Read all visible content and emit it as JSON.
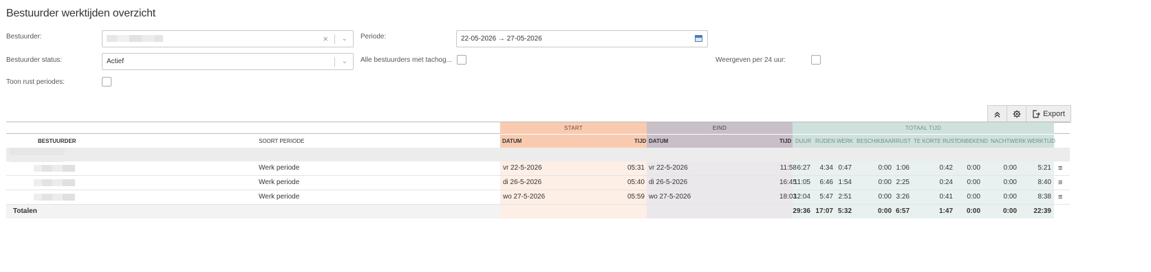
{
  "title": "Bestuurder werktijden overzicht",
  "filters": {
    "bestuurder_label": "Bestuurder:",
    "periode_label": "Periode:",
    "periode_value": "22-05-2026 → 27-05-2026",
    "status_label": "Bestuurder status:",
    "status_value": "Actief",
    "tachograaf_label": "Alle bestuurders met tachog...",
    "per24_label": "Weergeven per 24 uur:",
    "rust_label": "Toon rust periodes:"
  },
  "toolbar": {
    "export_label": "Export"
  },
  "table": {
    "bands": {
      "start": "START",
      "eind": "EIND",
      "totaal": "TOTAAL TIJD"
    },
    "headers": {
      "bestuurder": "BESTUURDER",
      "soort": "SOORT PERIODE",
      "start_datum": "DATUM",
      "start_tijd": "TIJD",
      "eind_datum": "DATUM",
      "eind_tijd": "TIJD",
      "duur": "DUUR",
      "rijden": "RIJDEN",
      "werk": "WERK",
      "beschikbaar": "BESCHIKBAAR",
      "rust": "RUST",
      "te_korte_rust": "TE KORTE RUST",
      "onbekend": "ONBEKEND",
      "nachtwerk": "NACHTWERK",
      "werktijd": "WERKTIJD"
    },
    "rows": [
      {
        "soort": "Werk periode",
        "start_datum": "vr 22-5-2026",
        "start_tijd": "05:31",
        "eind_datum": "vr 22-5-2026",
        "eind_tijd": "11:58",
        "duur": "6:27",
        "rijden": "4:34",
        "werk": "0:47",
        "beschikbaar": "0:00",
        "rust": "1:06",
        "te_korte_rust": "0:42",
        "onbekend": "0:00",
        "nachtwerk": "0:00",
        "werktijd": "5:21"
      },
      {
        "soort": "Werk periode",
        "start_datum": "di 26-5-2026",
        "start_tijd": "05:40",
        "eind_datum": "di 26-5-2026",
        "eind_tijd": "16:45",
        "duur": "11:05",
        "rijden": "6:46",
        "werk": "1:54",
        "beschikbaar": "0:00",
        "rust": "2:25",
        "te_korte_rust": "0:24",
        "onbekend": "0:00",
        "nachtwerk": "0:00",
        "werktijd": "8:40"
      },
      {
        "soort": "Werk periode",
        "start_datum": "wo 27-5-2026",
        "start_tijd": "05:59",
        "eind_datum": "wo 27-5-2026",
        "eind_tijd": "18:03",
        "duur": "12:04",
        "rijden": "5:47",
        "werk": "2:51",
        "beschikbaar": "0:00",
        "rust": "3:26",
        "te_korte_rust": "0:41",
        "onbekend": "0:00",
        "nachtwerk": "0:00",
        "werktijd": "8:38"
      }
    ],
    "totals": {
      "label": "Totalen",
      "duur": "29:36",
      "rijden": "17:07",
      "werk": "5:32",
      "beschikbaar": "0:00",
      "rust": "6:57",
      "te_korte_rust": "1:47",
      "onbekend": "0:00",
      "nachtwerk": "0:00",
      "werktijd": "22:39"
    }
  },
  "colors": {
    "start_band": "#f8cbb0",
    "start_body": "#fdeee6",
    "eind_band": "#c9bfc8",
    "eind_body": "#ebe8ec",
    "totaal_band": "#cfe1dd",
    "totaal_body": "#e8f1ef"
  }
}
